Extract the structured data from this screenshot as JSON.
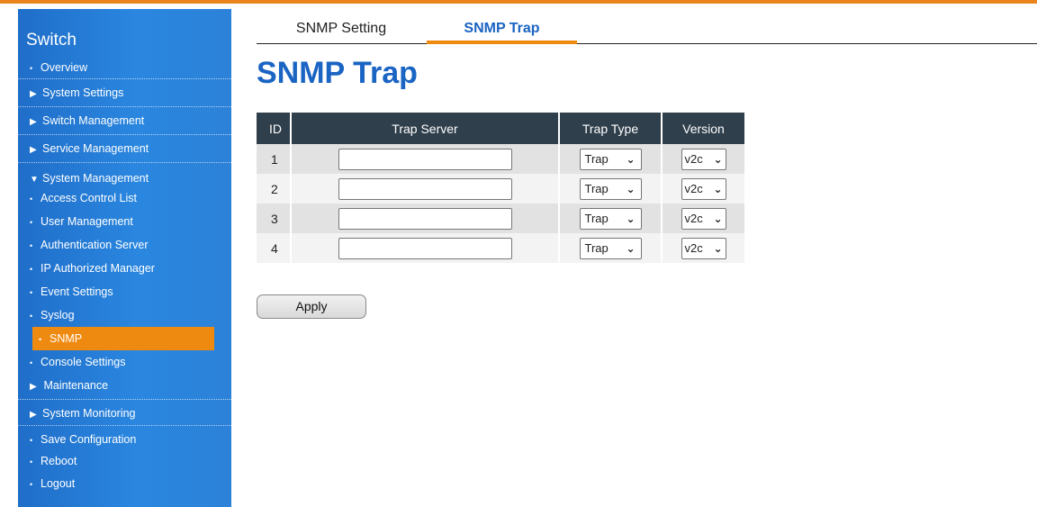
{
  "sidebar": {
    "title": "Switch",
    "items": [
      {
        "label": "Overview",
        "marker": "•",
        "kind": "bullet"
      },
      {
        "label": "System Settings",
        "marker": "▶",
        "kind": "tri"
      },
      {
        "label": "Switch Management",
        "marker": "▶",
        "kind": "tri"
      },
      {
        "label": "Service Management",
        "marker": "▶",
        "kind": "tri"
      },
      {
        "label": "System Management",
        "marker": "▼",
        "kind": "tri"
      },
      {
        "label": "Access Control List",
        "marker": "•",
        "kind": "sub"
      },
      {
        "label": "User Management",
        "marker": "•",
        "kind": "sub"
      },
      {
        "label": "Authentication Server",
        "marker": "•",
        "kind": "sub"
      },
      {
        "label": "IP Authorized Manager",
        "marker": "•",
        "kind": "sub"
      },
      {
        "label": "Event Settings",
        "marker": "•",
        "kind": "sub"
      },
      {
        "label": "Syslog",
        "marker": "•",
        "kind": "sub"
      },
      {
        "label": "SNMP",
        "marker": "•",
        "kind": "sub-active"
      },
      {
        "label": "Console Settings",
        "marker": "•",
        "kind": "sub"
      },
      {
        "label": "Maintenance",
        "marker": "▶",
        "kind": "sub"
      },
      {
        "label": "System Monitoring",
        "marker": "▶",
        "kind": "tri"
      },
      {
        "label": "Save Configuration",
        "marker": "•",
        "kind": "bullet"
      },
      {
        "label": "Reboot",
        "marker": "•",
        "kind": "bullet"
      },
      {
        "label": "Logout",
        "marker": "•",
        "kind": "bullet"
      }
    ]
  },
  "tabs": {
    "setting": "SNMP Setting",
    "trap": "SNMP Trap"
  },
  "page_title": "SNMP Trap",
  "table": {
    "headers": {
      "id": "ID",
      "server": "Trap Server",
      "type": "Trap Type",
      "version": "Version"
    },
    "rows": [
      {
        "id": "1",
        "server": "",
        "type": "Trap",
        "version": "v2c"
      },
      {
        "id": "2",
        "server": "",
        "type": "Trap",
        "version": "v2c"
      },
      {
        "id": "3",
        "server": "",
        "type": "Trap",
        "version": "v2c"
      },
      {
        "id": "4",
        "server": "",
        "type": "Trap",
        "version": "v2c"
      }
    ]
  },
  "apply_label": "Apply",
  "colors": {
    "accent": "#ef8a10",
    "brand_blue": "#1a64c3",
    "header_bg": "#2f3f4c"
  }
}
